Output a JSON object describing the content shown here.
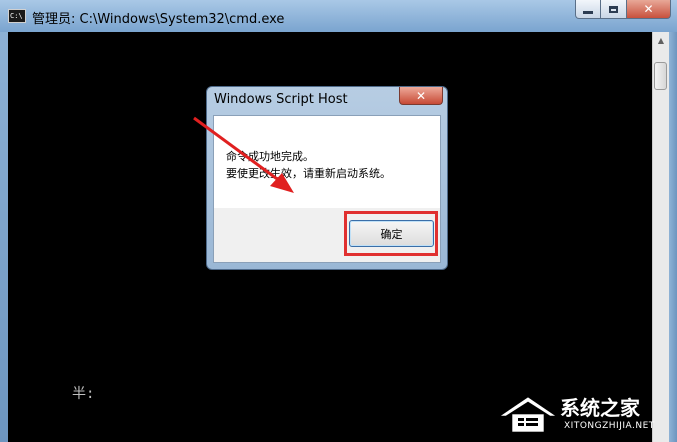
{
  "cmd_window": {
    "title": "管理员: C:\\Windows\\System32\\cmd.exe",
    "icon": "cmd-icon",
    "icon_text": "C:\\",
    "console_text": "半:"
  },
  "dialog": {
    "title": "Windows Script Host",
    "close_icon": "close-icon",
    "message_line1": "命令成功地完成。",
    "message_line2": "要使更改生效，请重新启动系统。",
    "ok_label": "确定"
  },
  "annotation": {
    "arrow_color": "#e02020",
    "highlight_color": "#e03030"
  },
  "watermark": {
    "text": "系统之家",
    "subtext": "XITONGZHIJIA.NET"
  }
}
